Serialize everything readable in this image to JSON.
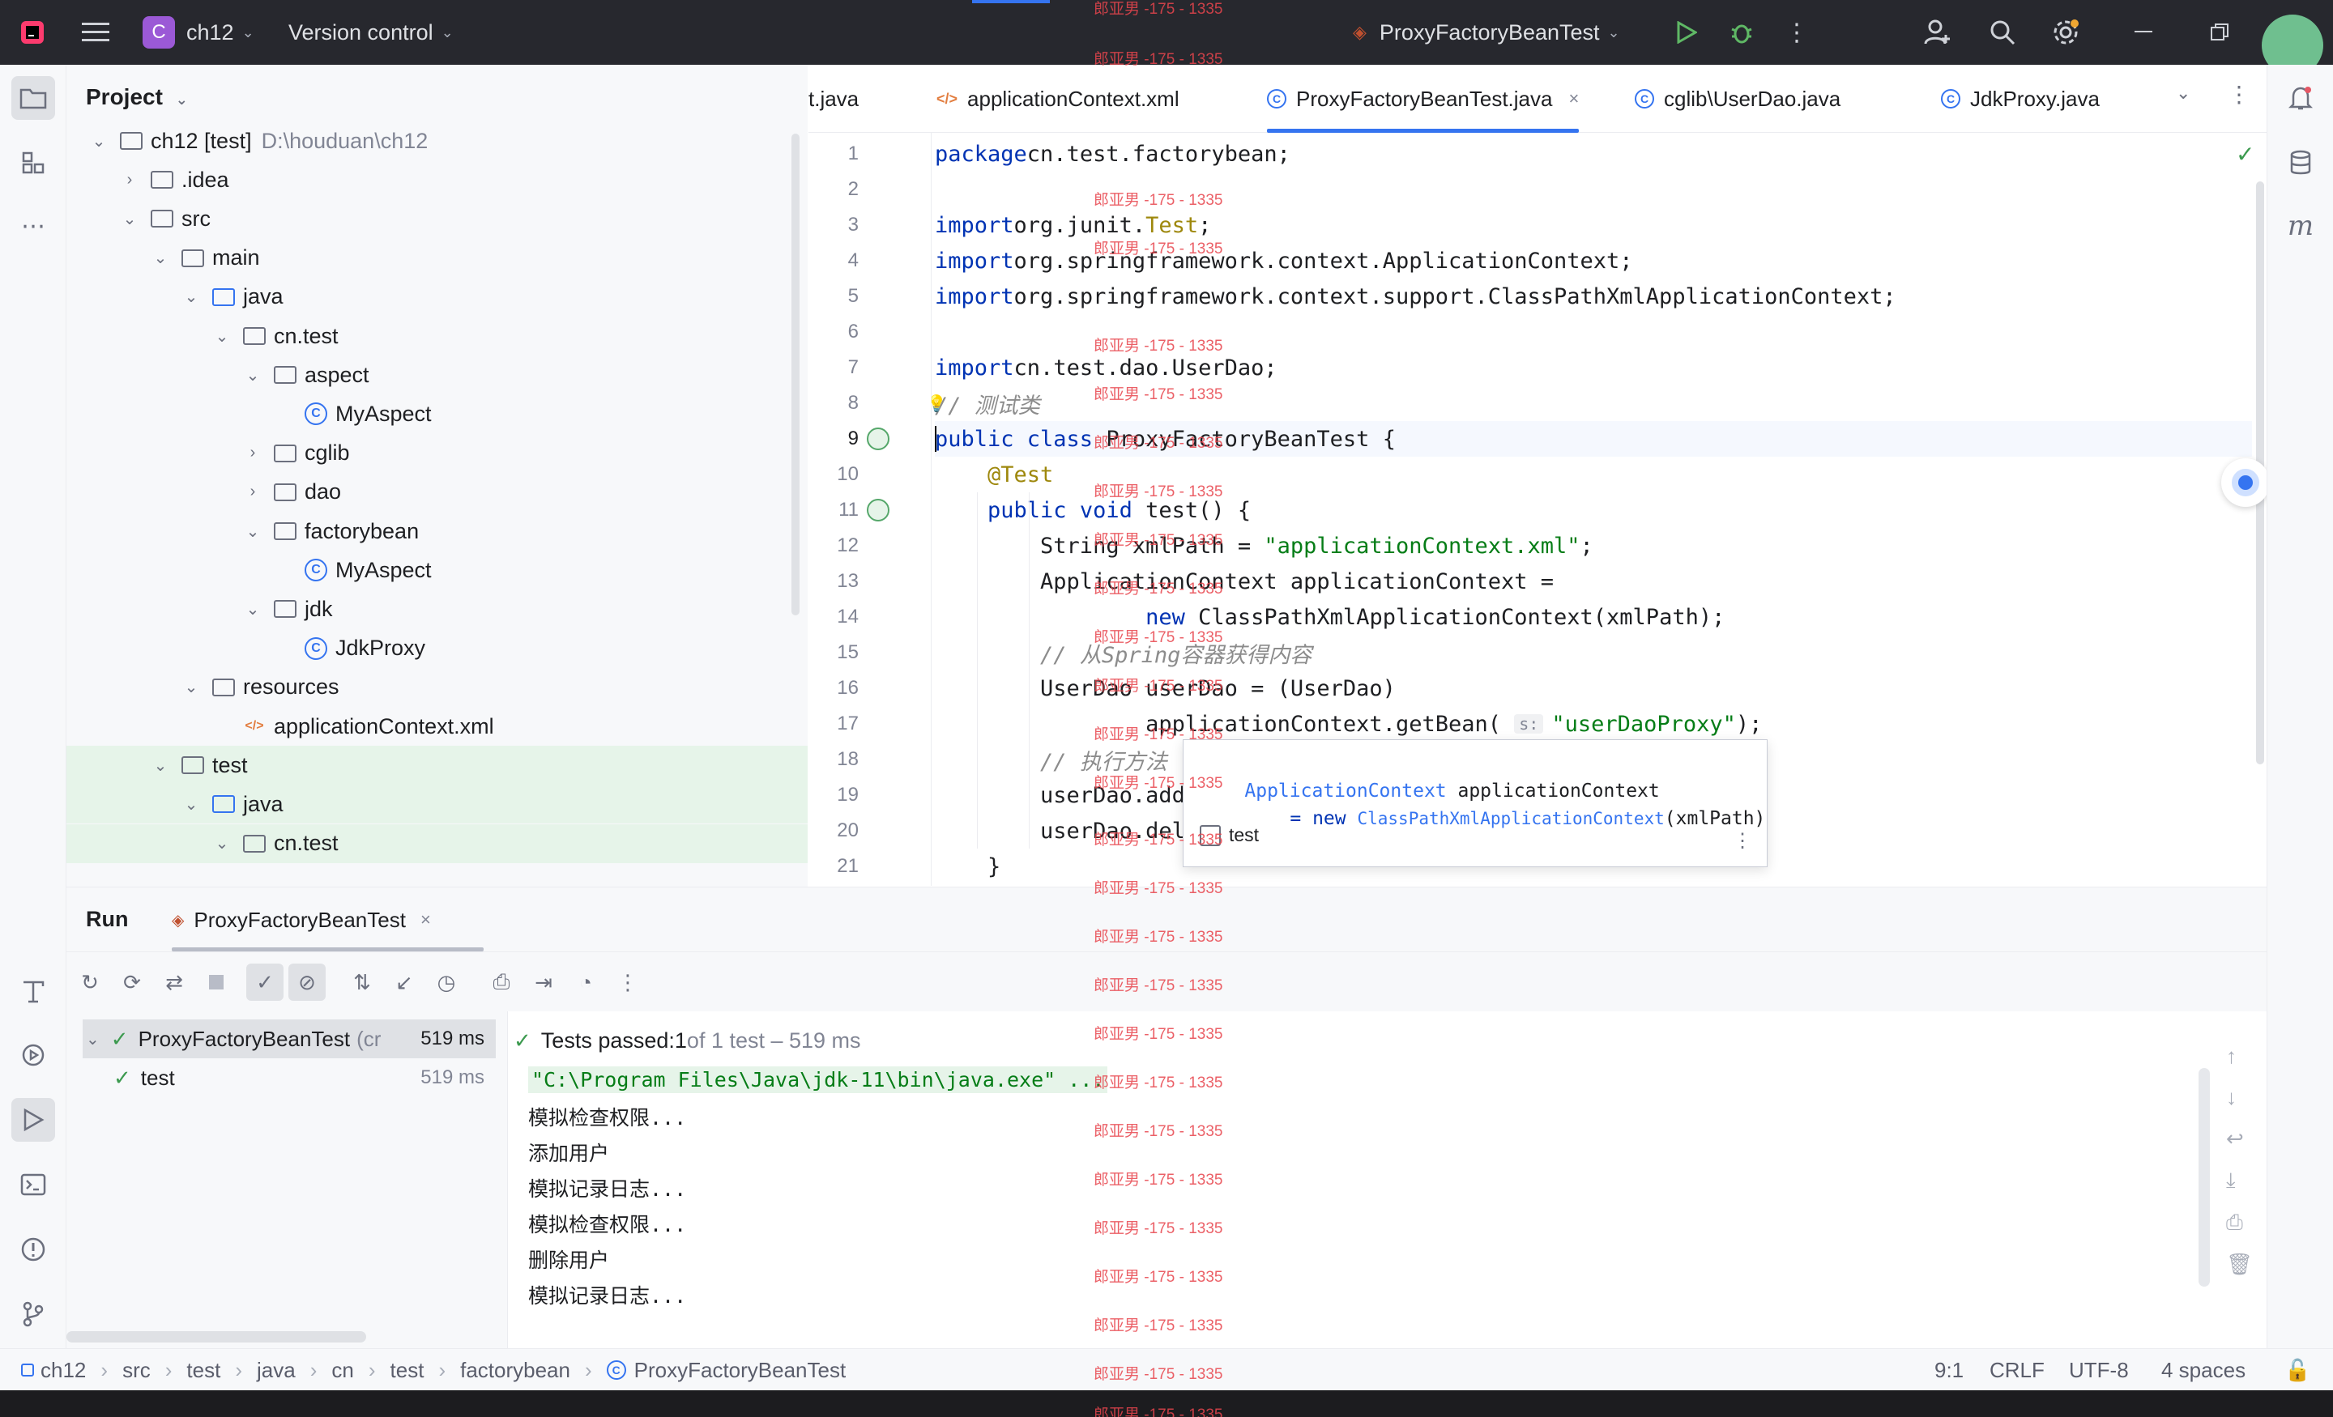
{
  "titlebar": {
    "project_name": "ch12",
    "project_badge": "C",
    "version_control": "Version control",
    "run_config": "ProxyFactoryBeanTest"
  },
  "project_panel": {
    "title": "Project",
    "tree": [
      {
        "label": "ch12 [test]",
        "muted": "D:\\houduan\\ch12",
        "icon": "module-folder-icon",
        "arrow": "v"
      },
      {
        "label": ".idea",
        "icon": "folder-icon",
        "arrow": ">"
      },
      {
        "label": "src",
        "icon": "folder-icon",
        "arrow": "v"
      },
      {
        "label": "main",
        "icon": "folder-icon",
        "arrow": "v"
      },
      {
        "label": "java",
        "icon": "source-folder-icon",
        "arrow": "v"
      },
      {
        "label": "cn.test",
        "icon": "package-icon",
        "arrow": "v"
      },
      {
        "label": "aspect",
        "icon": "package-icon",
        "arrow": "v"
      },
      {
        "label": "MyAspect",
        "icon": "class-icon",
        "arrow": ""
      },
      {
        "label": "cglib",
        "icon": "package-icon",
        "arrow": ">"
      },
      {
        "label": "dao",
        "icon": "package-icon",
        "arrow": ">"
      },
      {
        "label": "factorybean",
        "icon": "package-icon",
        "arrow": "v"
      },
      {
        "label": "MyAspect",
        "icon": "class-icon",
        "arrow": ""
      },
      {
        "label": "jdk",
        "icon": "package-icon",
        "arrow": "v"
      },
      {
        "label": "JdkProxy",
        "icon": "class-icon",
        "arrow": ""
      },
      {
        "label": "resources",
        "icon": "resources-folder-icon",
        "arrow": "v"
      },
      {
        "label": "applicationContext.xml",
        "icon": "xml-file-icon",
        "arrow": ""
      },
      {
        "label": "test",
        "icon": "folder-icon",
        "arrow": "v"
      },
      {
        "label": "java",
        "icon": "test-folder-icon",
        "arrow": "v"
      },
      {
        "label": "cn.test",
        "icon": "package-icon",
        "arrow": "v"
      }
    ]
  },
  "editor": {
    "tabs": [
      {
        "label": "t.java",
        "icon": "java-file-icon"
      },
      {
        "label": "applicationContext.xml",
        "icon": "xml-file-icon"
      },
      {
        "label": "ProxyFactoryBeanTest.java",
        "icon": "class-icon",
        "close": "×"
      },
      {
        "label": "cglib\\UserDao.java",
        "icon": "class-icon"
      },
      {
        "label": "JdkProxy.java",
        "icon": "class-icon"
      }
    ],
    "lines": [
      {
        "n": "1",
        "tokens": [
          [
            "kw",
            "package"
          ],
          [
            "",
            "cn.test.factorybean;"
          ]
        ]
      },
      {
        "n": "2",
        "tokens": []
      },
      {
        "n": "3",
        "tokens": [
          [
            "kw",
            "import"
          ],
          [
            "",
            "org.junit."
          ],
          [
            "ann",
            "Test"
          ],
          [
            "",
            ";"
          ]
        ]
      },
      {
        "n": "4",
        "tokens": [
          [
            "kw",
            "import"
          ],
          [
            "",
            "org.springframework.context.ApplicationContext;"
          ]
        ]
      },
      {
        "n": "5",
        "tokens": [
          [
            "kw",
            "import"
          ],
          [
            "",
            "org.springframework.context.support.ClassPathXmlApplicationContext;"
          ]
        ]
      },
      {
        "n": "6",
        "tokens": []
      },
      {
        "n": "7",
        "tokens": [
          [
            "kw",
            "import"
          ],
          [
            "",
            "cn.test.dao.UserDao;"
          ]
        ]
      },
      {
        "n": "8",
        "tokens": [
          [
            "cmt",
            "// 测试类"
          ]
        ]
      },
      {
        "n": "9",
        "tokens": [
          [
            "kw",
            "public class "
          ],
          [
            "",
            "ProxyFactoryBeanTest {"
          ]
        ]
      },
      {
        "n": "10",
        "tokens": [
          [
            "",
            "    "
          ],
          [
            "ann",
            "@Test"
          ]
        ]
      },
      {
        "n": "11",
        "tokens": [
          [
            "",
            "    "
          ],
          [
            "kw",
            "public void "
          ],
          [
            "",
            "test() {"
          ]
        ]
      },
      {
        "n": "12",
        "tokens": [
          [
            "",
            "        String xmlPath = "
          ],
          [
            "str",
            "\"applicationContext.xml\""
          ],
          [
            "",
            ";"
          ]
        ]
      },
      {
        "n": "13",
        "tokens": [
          [
            "",
            "        ApplicationContext applicationContext ="
          ]
        ]
      },
      {
        "n": "14",
        "tokens": [
          [
            "",
            "                "
          ],
          [
            "kw",
            "new "
          ],
          [
            "",
            "ClassPathXmlApplicationContext(xmlPath);"
          ]
        ]
      },
      {
        "n": "15",
        "tokens": [
          [
            "",
            "        "
          ],
          [
            "cmt",
            "// 从Spring容器获得内容"
          ]
        ]
      },
      {
        "n": "16",
        "tokens": [
          [
            "",
            "        UserDao userDao = (UserDao)"
          ]
        ]
      },
      {
        "n": "17",
        "tokens": [
          [
            "",
            "                applicationContext.getBean( "
          ],
          [
            "hint",
            "s:"
          ],
          [
            "str",
            "\"userDaoProxy\""
          ],
          [
            "",
            ");"
          ]
        ]
      },
      {
        "n": "18",
        "tokens": [
          [
            "",
            "        "
          ],
          [
            "cmt",
            "// 执行方法"
          ]
        ]
      },
      {
        "n": "19",
        "tokens": [
          [
            "",
            "        userDao.add"
          ]
        ]
      },
      {
        "n": "20",
        "tokens": [
          [
            "",
            "        userDao.del"
          ]
        ]
      },
      {
        "n": "21",
        "tokens": [
          [
            "",
            "    }"
          ]
        ]
      }
    ],
    "popup": {
      "type": "ApplicationContext",
      "var": " applicationContext",
      "line2_kw": "= new ",
      "line2_type": "ClassPathXmlApplicationContext",
      "line2_rest": "(xmlPath)",
      "method": "test"
    }
  },
  "run_panel": {
    "title": "Run",
    "tab": "ProxyFactoryBeanTest",
    "tab_close": "×",
    "tree": [
      {
        "label": "ProxyFactoryBeanTest",
        "suffix": "(cr",
        "time": "519 ms"
      },
      {
        "label": "test",
        "suffix": "",
        "time": "519 ms"
      }
    ],
    "status_prefix": "Tests passed: ",
    "status_count": "1",
    "status_rest": " of 1 test – 519 ms",
    "console": [
      "\"C:\\Program Files\\Java\\jdk-11\\bin\\java.exe\" ...",
      "模拟检查权限...",
      "添加用户",
      "模拟记录日志...",
      "模拟检查权限...",
      "删除用户",
      "模拟记录日志..."
    ]
  },
  "statusbar": {
    "breadcrumbs": [
      "ch12",
      "src",
      "test",
      "java",
      "cn",
      "test",
      "factorybean",
      "ProxyFactoryBeanTest"
    ],
    "position": "9:1",
    "line_sep": "CRLF",
    "encoding": "UTF-8",
    "indent": "4 spaces"
  },
  "watermark": {
    "text": "郎亚男 -175 - 1335"
  },
  "colors": {
    "accent": "#3574f0",
    "success": "#3c9a4f",
    "titlebar": "#27282e",
    "watermark": "#e8454d"
  }
}
